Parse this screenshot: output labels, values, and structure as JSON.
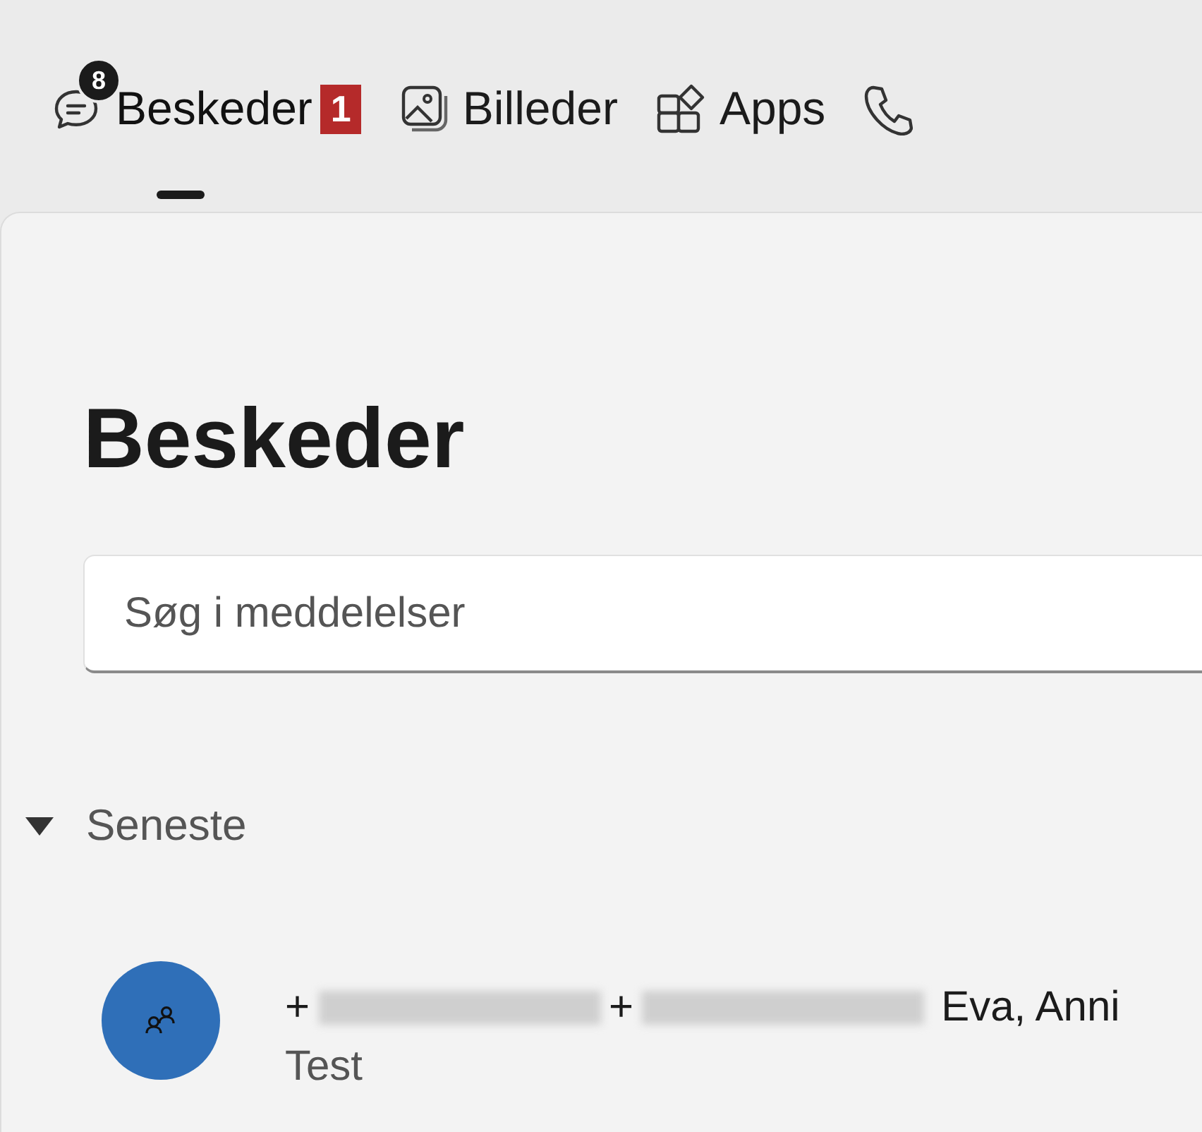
{
  "tabs": [
    {
      "label": "Beskeder",
      "selected": true,
      "badge": "8",
      "callout": "1"
    },
    {
      "label": "Billeder",
      "selected": false
    },
    {
      "label": "Apps",
      "selected": false
    },
    {
      "selected": false
    }
  ],
  "page": {
    "title": "Beskeder"
  },
  "search": {
    "placeholder": "Søg i meddelelser"
  },
  "section": {
    "label": "Seneste",
    "expanded": true
  },
  "conversations": [
    {
      "name_parts": [
        {
          "kind": "text",
          "text": "+"
        },
        {
          "kind": "redacted"
        },
        {
          "kind": "text",
          "text": "+"
        },
        {
          "kind": "redacted"
        },
        {
          "kind": "text",
          "text": "Eva, Anni"
        }
      ],
      "preview": "Test"
    }
  ]
}
